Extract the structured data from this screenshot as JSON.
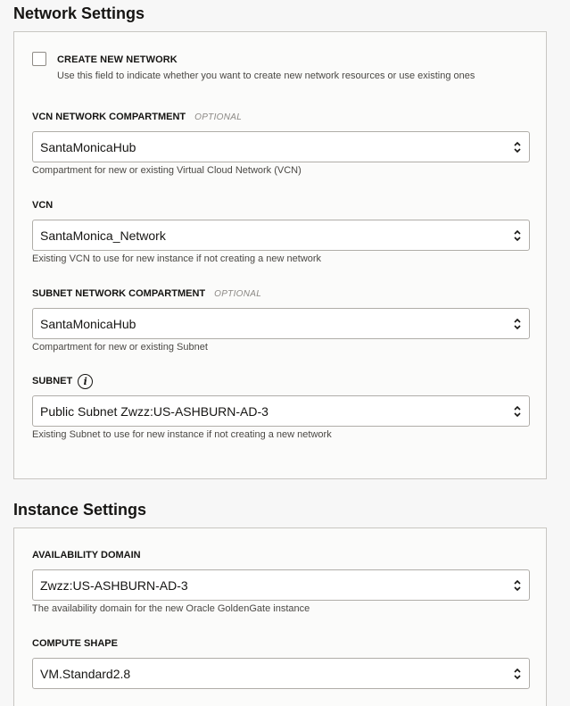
{
  "network_settings": {
    "title": "Network Settings",
    "create_network": {
      "label": "CREATE NEW NETWORK",
      "helper": "Use this field to indicate whether you want to create new network resources or use existing ones",
      "checked": false
    },
    "vcn_compartment": {
      "label": "VCN NETWORK COMPARTMENT",
      "optional": "OPTIONAL",
      "value": "SantaMonicaHub",
      "helper": "Compartment for new or existing Virtual Cloud Network (VCN)"
    },
    "vcn": {
      "label": "VCN",
      "value": "SantaMonica_Network",
      "helper": "Existing VCN to use for new instance if not creating a new network"
    },
    "subnet_compartment": {
      "label": "SUBNET NETWORK COMPARTMENT",
      "optional": "OPTIONAL",
      "value": "SantaMonicaHub",
      "helper": "Compartment for new or existing Subnet"
    },
    "subnet": {
      "label": "SUBNET",
      "info_icon_glyph": "i",
      "value": "Public Subnet Zwzz:US-ASHBURN-AD-3",
      "helper": "Existing Subnet to use for new instance if not creating a new network"
    }
  },
  "instance_settings": {
    "title": "Instance Settings",
    "availability_domain": {
      "label": "AVAILABILITY DOMAIN",
      "value": "Zwzz:US-ASHBURN-AD-3",
      "helper": "The availability domain for the new Oracle GoldenGate instance"
    },
    "compute_shape": {
      "label": "COMPUTE SHAPE",
      "value": "VM.Standard2.8"
    }
  }
}
